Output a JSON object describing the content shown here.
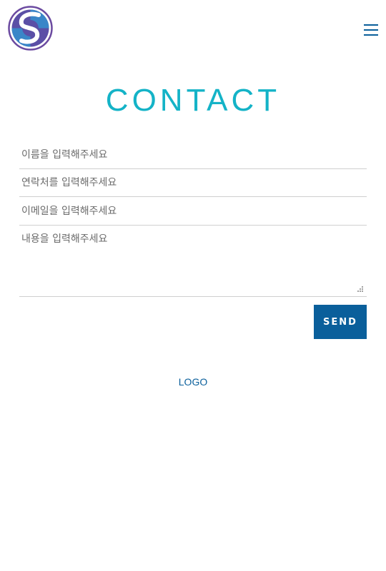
{
  "header": {
    "logo_icon": "s-circle-logo-icon",
    "menu_icon": "hamburger-menu-icon",
    "accent_color": "#14b3c7",
    "brand_color": "#0a5f9b"
  },
  "main": {
    "title": "CONTACT",
    "form": {
      "name_placeholder": "이름을 입력해주세요",
      "phone_placeholder": "연락처를 입력해주세요",
      "email_placeholder": "이메일을 입력해주세요",
      "message_placeholder": "내용을 입력해주세요",
      "send_label": "SEND"
    }
  },
  "footer": {
    "logo_text": "LOGO"
  }
}
